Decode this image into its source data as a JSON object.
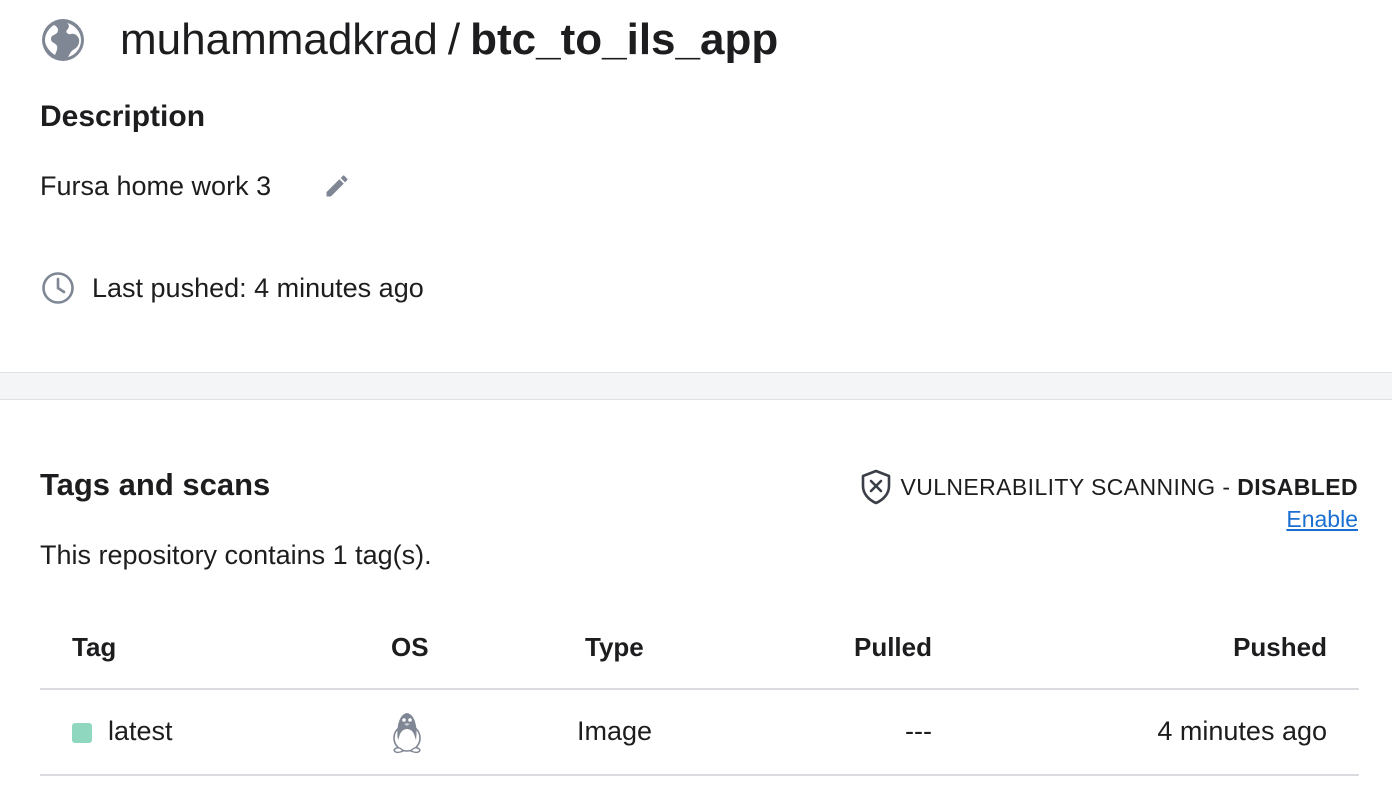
{
  "header": {
    "namespace": "muhammadkrad",
    "separator": "/",
    "repo_name": "btc_to_ils_app",
    "visibility_icon": "globe-icon"
  },
  "description": {
    "heading": "Description",
    "text": "Fursa home work 3",
    "edit_icon": "pencil-icon"
  },
  "last_pushed": {
    "icon": "clock-icon",
    "text": "Last pushed: 4 minutes ago"
  },
  "tags_section": {
    "heading": "Tags and scans",
    "count_text": "This repository contains 1 tag(s).",
    "vulnerability": {
      "icon": "shield-x-icon",
      "label": "VULNERABILITY SCANNING - ",
      "status": "DISABLED",
      "enable_link": "Enable",
      "link_color": "#1b6fd1"
    },
    "table": {
      "columns": [
        "Tag",
        "OS",
        "Type",
        "Pulled",
        "Pushed"
      ],
      "rows": [
        {
          "tag": "latest",
          "tag_color": "#8fd8bf",
          "os_icon": "linux-tux-icon",
          "type": "Image",
          "pulled": "---",
          "pushed": "4 minutes ago"
        }
      ]
    }
  }
}
